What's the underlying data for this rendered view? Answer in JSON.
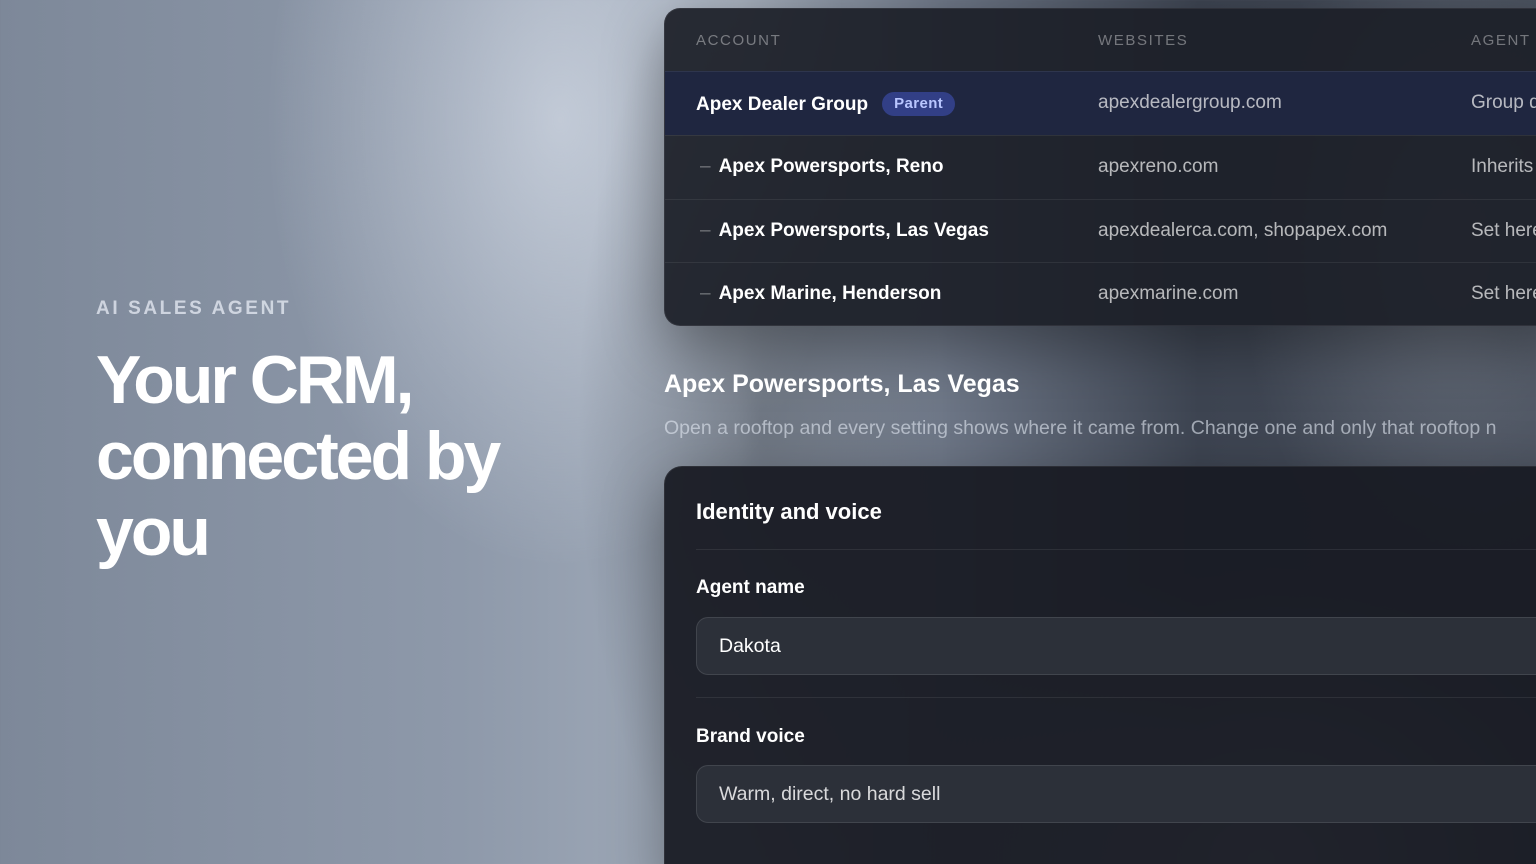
{
  "hero": {
    "eyebrow": "AI SALES AGENT",
    "headline_lines": [
      "Your CRM,",
      "connected by",
      "you"
    ]
  },
  "accounts_table": {
    "columns": [
      "ACCOUNT",
      "WEBSITES",
      "AGENT"
    ],
    "rows": [
      {
        "account": "Apex Dealer Group",
        "badge": "Parent",
        "child": false,
        "websites": "apexdealergroup.com",
        "agent": "Group d",
        "selected": true
      },
      {
        "account": "Apex Powersports, Reno",
        "badge": "",
        "child": true,
        "websites": "apexreno.com",
        "agent": "Inherits",
        "selected": false
      },
      {
        "account": "Apex Powersports, Las Vegas",
        "badge": "",
        "child": true,
        "websites": "apexdealerca.com, shopapex.com",
        "agent": "Set here",
        "selected": false
      },
      {
        "account": "Apex Marine, Henderson",
        "badge": "",
        "child": true,
        "websites": "apexmarine.com",
        "agent": "Set here",
        "selected": false
      }
    ],
    "child_marker": "–"
  },
  "detail": {
    "title": "Apex Powersports, Las Vegas",
    "subtitle": "Open a rooftop and every setting shows where it came from. Change one and only that rooftop n"
  },
  "identity_card": {
    "title": "Identity and voice",
    "fields": [
      {
        "label": "Agent name",
        "value": "Dakota"
      },
      {
        "label": "Brand voice",
        "value": "Warm, direct, no hard sell"
      }
    ]
  },
  "colors": {
    "accent_badge_bg": "#323f86",
    "accent_badge_text": "#b9c6ff",
    "selected_row": "#1f2640"
  }
}
